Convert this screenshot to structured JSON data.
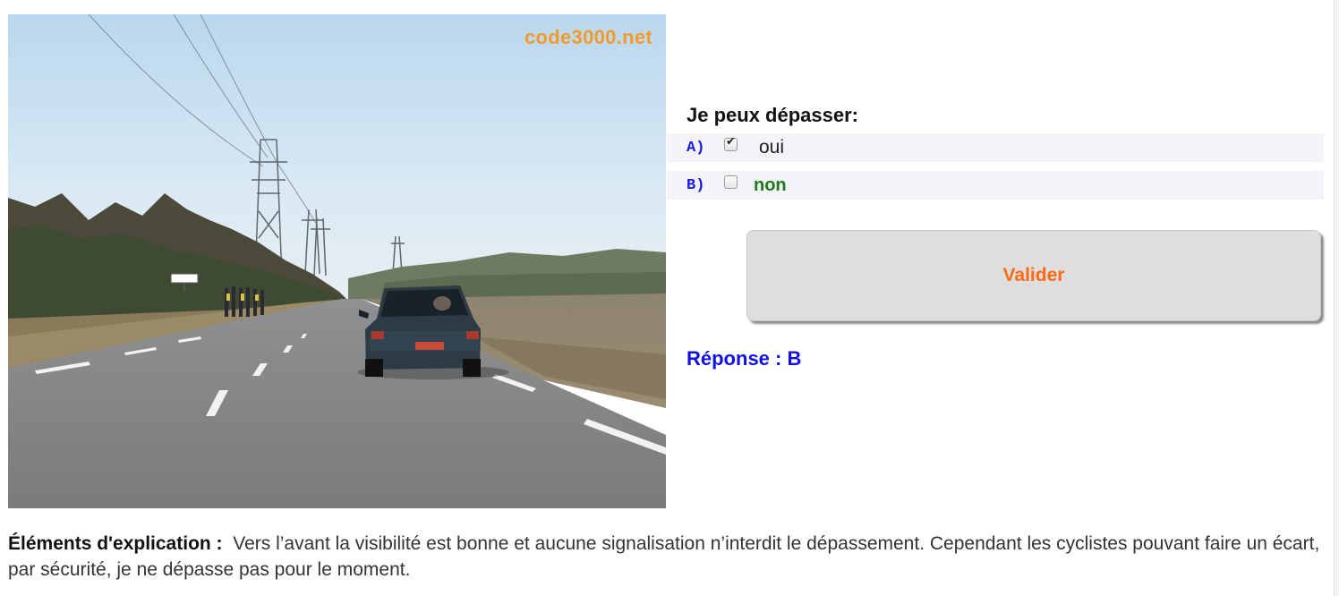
{
  "watermark": "code3000.net",
  "question": {
    "title": "Je peux dépasser:",
    "options": [
      {
        "letter": "A)",
        "label": "oui",
        "checked": true
      },
      {
        "letter": "B)",
        "label": "non",
        "checked": false
      }
    ]
  },
  "validate_label": "Valider",
  "answer": "Réponse : B",
  "explanation": {
    "label": "Éléments d'explication :",
    "text": "Vers l’avant la visibilité est bonne et aucune signalisation n’interdit le dépassement. Cependant les cyclistes pouvant faire un écart, par sécurité, je ne dépasse pas pour le moment."
  },
  "colors": {
    "option_letter": "#1a1ae0",
    "option_b_text": "#1d7a1d",
    "validate_text": "#ff6a13",
    "answer": "#1010e6",
    "watermark": "#f39a2c"
  }
}
